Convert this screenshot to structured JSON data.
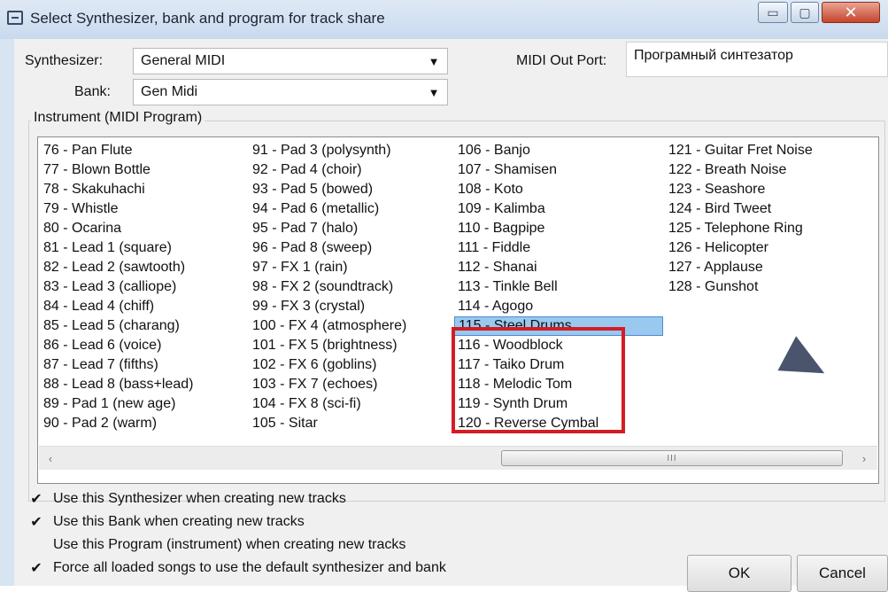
{
  "window": {
    "title": "Select Synthesizer, bank and program for track share",
    "minimize_glyph": "▭",
    "maximize_glyph": "▢",
    "close_glyph": "✕"
  },
  "synth": {
    "label": "Synthesizer:",
    "value": "General MIDI",
    "arrow": "▼"
  },
  "bank": {
    "label": "Bank:",
    "value": "Gen Midi",
    "arrow": "▼"
  },
  "port": {
    "label": "MIDI Out Port:",
    "value": "Програмный синтезатор"
  },
  "instrument": {
    "group_title": "Instrument (MIDI Program)",
    "columns": [
      [
        "76 - Pan Flute",
        "77 - Blown Bottle",
        "78 - Skakuhachi",
        "79 - Whistle",
        "80 - Ocarina",
        "81 - Lead 1 (square)",
        "82 - Lead 2 (sawtooth)",
        "83 - Lead 3 (calliope)",
        "84 - Lead 4 (chiff)",
        "85 - Lead 5 (charang)",
        "86 - Lead 6 (voice)",
        "87 - Lead 7 (fifths)",
        "88 - Lead 8 (bass+lead)",
        "89 - Pad 1 (new age)",
        "90 - Pad 2 (warm)"
      ],
      [
        "91 - Pad 3 (polysynth)",
        "92 - Pad 4 (choir)",
        "93 - Pad 5 (bowed)",
        "94 - Pad 6 (metallic)",
        "95 - Pad 7 (halo)",
        "96 - Pad 8 (sweep)",
        "97 - FX 1 (rain)",
        "98 - FX 2 (soundtrack)",
        "99 - FX 3 (crystal)",
        "100 - FX 4 (atmosphere)",
        "101 - FX 5 (brightness)",
        "102 - FX 6 (goblins)",
        "103 - FX 7 (echoes)",
        "104 - FX 8 (sci-fi)",
        "105 - Sitar"
      ],
      [
        "106 - Banjo",
        "107 - Shamisen",
        "108 - Koto",
        "109 - Kalimba",
        "110 - Bagpipe",
        "111 - Fiddle",
        "112 - Shanai",
        "113 - Tinkle Bell",
        "114 - Agogo",
        "115 - Steel Drums",
        "116 - Woodblock",
        "117 - Taiko Drum",
        "118 - Melodic Tom",
        "119 - Synth Drum",
        "120 - Reverse Cymbal"
      ],
      [
        "121 - Guitar Fret Noise",
        "122 - Breath Noise",
        "123 - Seashore",
        "124 - Bird Tweet",
        "125 - Telephone Ring",
        "126 - Helicopter",
        "127 - Applause",
        "128 - Gunshot"
      ]
    ],
    "selected": "115 - Steel Drums",
    "highlight_color": "#d51c24",
    "selection_color": "#99c9ef"
  },
  "scrollbar": {
    "left_arrow": "‹",
    "right_arrow": "›",
    "thumb_grip": "III"
  },
  "options": [
    {
      "label": "Use this Synthesizer when creating new tracks",
      "checked": true
    },
    {
      "label": "Use this Bank when creating new tracks",
      "checked": true
    },
    {
      "label": "Use this Program (instrument) when creating new tracks",
      "checked": false
    },
    {
      "label": "Force all loaded songs to use the default synthesizer and bank",
      "checked": true
    }
  ],
  "buttons": {
    "ok": "OK",
    "cancel": "Cancel"
  }
}
